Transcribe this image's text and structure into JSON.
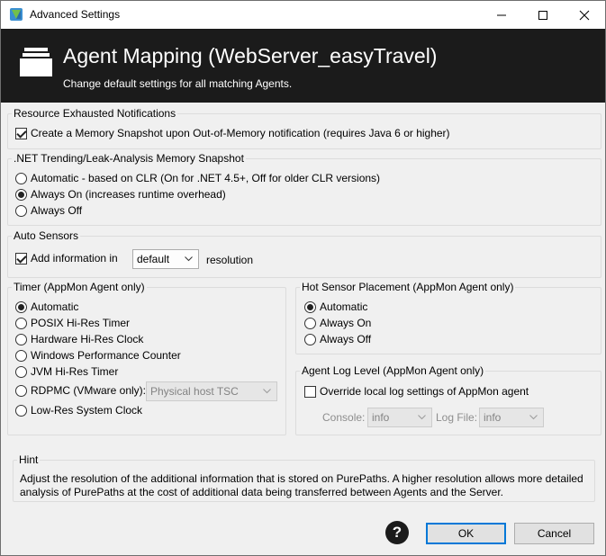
{
  "window": {
    "title": "Advanced Settings"
  },
  "header": {
    "title": "Agent Mapping (WebServer_easyTravel)",
    "subtitle": "Change default settings for all matching Agents."
  },
  "resource_exhausted": {
    "legend": "Resource Exhausted Notifications",
    "memory_snapshot": {
      "label": "Create a Memory Snapshot upon Out-of-Memory notification (requires Java 6 or higher)",
      "checked": true
    }
  },
  "net_trending": {
    "legend": ".NET Trending/Leak-Analysis Memory Snapshot",
    "options": [
      {
        "label": "Automatic - based on CLR (On for .NET 4.5+, Off for older CLR versions)",
        "selected": false
      },
      {
        "label": "Always On (increases runtime overhead)",
        "selected": true
      },
      {
        "label": "Always Off",
        "selected": false
      }
    ]
  },
  "auto_sensors": {
    "legend": "Auto Sensors",
    "add_info_label": "Add information in",
    "add_info_checked": true,
    "resolution_value": "default",
    "resolution_suffix": "resolution"
  },
  "timer": {
    "legend": "Timer (AppMon Agent only)",
    "options": [
      {
        "label": "Automatic",
        "selected": true
      },
      {
        "label": "POSIX Hi-Res Timer",
        "selected": false
      },
      {
        "label": "Hardware Hi-Res Clock",
        "selected": false
      },
      {
        "label": "Windows Performance Counter",
        "selected": false
      },
      {
        "label": "JVM Hi-Res Timer",
        "selected": false
      },
      {
        "label": "RDPMC (VMware only):",
        "selected": false
      },
      {
        "label": "Low-Res System Clock",
        "selected": false
      }
    ],
    "rdpmc_select": "Physical host TSC"
  },
  "hot_sensor": {
    "legend": "Hot Sensor Placement (AppMon Agent only)",
    "options": [
      {
        "label": "Automatic",
        "selected": true
      },
      {
        "label": "Always On",
        "selected": false
      },
      {
        "label": "Always Off",
        "selected": false
      }
    ]
  },
  "log_level": {
    "legend": "Agent Log Level (AppMon Agent only)",
    "override_label": "Override local log settings of AppMon agent",
    "override_checked": false,
    "console_label": "Console:",
    "console_value": "info",
    "logfile_label": "Log File:",
    "logfile_value": "info"
  },
  "hint": {
    "legend": "Hint",
    "text": "Adjust the resolution of the additional information that is stored on PurePaths. A higher resolution allows more detailed analysis of PurePaths at the cost of additional data being transferred between Agents and the Server."
  },
  "buttons": {
    "help": "?",
    "ok": "OK",
    "cancel": "Cancel"
  },
  "colors": {
    "header_bg": "#1b1b1b",
    "accent": "#0078d7",
    "window_bg": "#f0f0f0"
  }
}
